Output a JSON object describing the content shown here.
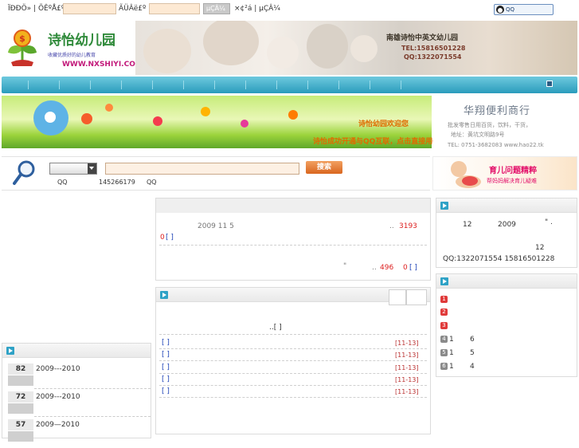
{
  "topbar": {
    "label_user": "Ï­ÐÐÖ» | ÕÊºÅ£º",
    "label_pass": "ÃÜÂë£º",
    "login_btn": "µÇÂ¼",
    "register_links": "×¢²á | µÇÂ¼",
    "qq_button": "QQ"
  },
  "header": {
    "logo_title": "诗怡幼儿园",
    "logo_sub": "收藏优质好的幼儿教育",
    "logo_url": "WWW.NXSHIYI.COM",
    "banner_name": "南雄诗怡中英文幼儿园",
    "banner_tel": "TEL:15816501228",
    "banner_qq": "QQ:1322071554"
  },
  "banner2": {
    "line1": "诗怡幼园欢迎您",
    "line2": "诗怡成功开通与QQ互联，点击直接用QQ号登录哦！"
  },
  "shop": {
    "title": "华翔便利商行",
    "line1": "批发零售日用百货，饮料，干货，",
    "line2": "地址：黄坑文明路9号",
    "line3": "TEL: 0751-3682083  www.hao22.tk"
  },
  "search": {
    "button": "搜索",
    "qq_label_a": "QQ",
    "qq_number": "145266179",
    "qq_label_b": "QQ"
  },
  "kid_banner": {
    "title": "育儿问题精粹",
    "subtitle": "帮妈妈解决育儿疑难"
  },
  "center1": {
    "line1_date": "2009 11 5",
    "line1_dots": "..",
    "line1_num": "3193",
    "line2_num": "0",
    "line2_bracket": "[ ]",
    "line3_mark": "\"",
    "line3_dots": "..",
    "line3_num": "496",
    "line3_num2": "0",
    "line3_bracket": "[ ]"
  },
  "center2": {
    "note": "..[ ]",
    "items": [
      {
        "bracket": "[ ]",
        "date": "[11-13]"
      },
      {
        "bracket": "[ ]",
        "date": "[11-13]"
      },
      {
        "bracket": "[ ]",
        "date": "[11-13]"
      },
      {
        "bracket": "[ ]",
        "date": "[11-13]"
      },
      {
        "bracket": "[ ]",
        "date": "[11-13]"
      }
    ]
  },
  "right1": {
    "l1a": "12",
    "l1b": "2009",
    "l1c": "\" .",
    "l2": "12",
    "contact": "QQ:1322071554   15816501228"
  },
  "right2": {
    "items": [
      {
        "rank": "1",
        "a": "",
        "b": ""
      },
      {
        "rank": "2",
        "a": "",
        "b": ""
      },
      {
        "rank": "3",
        "a": "",
        "b": ""
      },
      {
        "rank": "4",
        "a": "1",
        "b": "6"
      },
      {
        "rank": "5",
        "a": "1",
        "b": "5"
      },
      {
        "rank": "6",
        "a": "1",
        "b": "4"
      }
    ]
  },
  "left_votes": [
    {
      "num": "82",
      "title": "2009---2010"
    },
    {
      "num": "72",
      "title": "2009---2010"
    },
    {
      "num": "57",
      "title": "2009—2010"
    }
  ],
  "colors": {
    "nav": "#2a9cbc",
    "accent": "#e3106a",
    "red": "#d22"
  }
}
